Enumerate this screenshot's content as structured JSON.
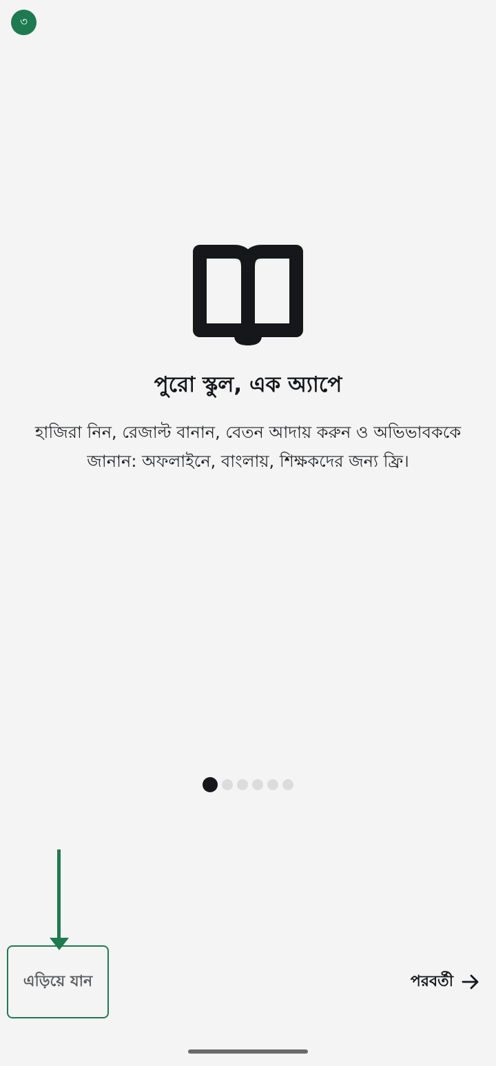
{
  "step_badge": {
    "text": "৩",
    "color": "#1e7a4f"
  },
  "hero": {
    "icon": "open-book-icon",
    "title": "পুরো স্কুল, এক অ্যাপে",
    "description": "হাজিরা নিন, রেজাল্ট বানান, বেতন আদায় করুন ও অভিভাবককে জানান: অফলাইনে, বাংলায়, শিক্ষকদের জন্য ফ্রি।"
  },
  "pager": {
    "total_pages": 6,
    "current_page": 1
  },
  "hint_arrow": {
    "icon": "arrow-down-icon",
    "color": "#1e7a4f"
  },
  "footer": {
    "skip_label": "এড়িয়ে যান",
    "next_label": "পরবর্তী",
    "next_icon": "arrow-right-icon"
  },
  "colors": {
    "background": "#f4f4f4",
    "accent": "#1e7a4f",
    "text": "#15171a",
    "dot_inactive": "#dcdcdc"
  }
}
